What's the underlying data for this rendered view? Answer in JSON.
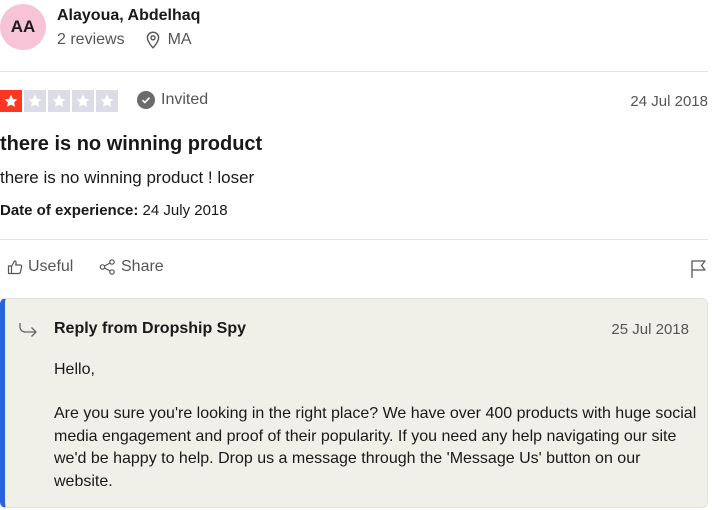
{
  "consumer": {
    "initials": "AA",
    "name": "Alayoua, Abdelhaq",
    "reviews": "2 reviews",
    "country": "MA",
    "avatar_color": "#f6c4d6"
  },
  "review": {
    "rating": 1,
    "max_rating": 5,
    "star_color": "#ff3722",
    "invited_label": "Invited",
    "date": "24 Jul 2018",
    "title": "there is no winning product",
    "body": "there is no winning product ! loser",
    "experience_label": "Date of experience:",
    "experience_date": " 24 July 2018"
  },
  "actions": {
    "useful_label": "Useful",
    "share_label": "Share",
    "useful_icon": "thumbs-up-icon",
    "share_icon": "share-icon",
    "flag_icon": "flag-icon"
  },
  "reply": {
    "title": "Reply from Dropship Spy",
    "date": "25 Jul 2018",
    "greeting": "Hello,",
    "text": "Are you sure you're looking in the right place? We have over 400 products with huge social media engagement and proof of their popularity. If you need any help navigating our site we'd be happy to help. Drop us a message through the 'Message Us' button on our website.",
    "accent_color": "#2764e0"
  }
}
